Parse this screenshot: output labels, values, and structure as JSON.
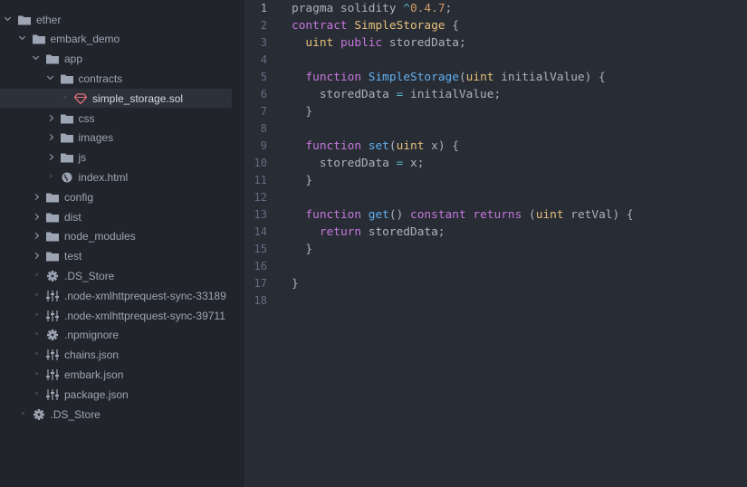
{
  "tree": {
    "items": [
      {
        "label": "ether",
        "depth": 0,
        "kind": "folder",
        "open": true
      },
      {
        "label": "embark_demo",
        "depth": 1,
        "kind": "folder",
        "open": true
      },
      {
        "label": "app",
        "depth": 2,
        "kind": "folder",
        "open": true
      },
      {
        "label": "contracts",
        "depth": 3,
        "kind": "folder",
        "open": true
      },
      {
        "label": "simple_storage.sol",
        "depth": 4,
        "kind": "file-solidity",
        "selected": true
      },
      {
        "label": "css",
        "depth": 3,
        "kind": "folder",
        "open": false
      },
      {
        "label": "images",
        "depth": 3,
        "kind": "folder",
        "open": false
      },
      {
        "label": "js",
        "depth": 3,
        "kind": "folder",
        "open": false
      },
      {
        "label": "index.html",
        "depth": 3,
        "kind": "file-html"
      },
      {
        "label": "config",
        "depth": 2,
        "kind": "folder",
        "open": false
      },
      {
        "label": "dist",
        "depth": 2,
        "kind": "folder",
        "open": false
      },
      {
        "label": "node_modules",
        "depth": 2,
        "kind": "folder",
        "open": false
      },
      {
        "label": "test",
        "depth": 2,
        "kind": "folder",
        "open": false
      },
      {
        "label": ".DS_Store",
        "depth": 2,
        "kind": "file-gear"
      },
      {
        "label": ".node-xmlhttprequest-sync-33189",
        "depth": 2,
        "kind": "file-config"
      },
      {
        "label": ".node-xmlhttprequest-sync-39711",
        "depth": 2,
        "kind": "file-config"
      },
      {
        "label": ".npmignore",
        "depth": 2,
        "kind": "file-gear"
      },
      {
        "label": "chains.json",
        "depth": 2,
        "kind": "file-config"
      },
      {
        "label": "embark.json",
        "depth": 2,
        "kind": "file-config"
      },
      {
        "label": "package.json",
        "depth": 2,
        "kind": "file-config"
      },
      {
        "label": ".DS_Store",
        "depth": 1,
        "kind": "file-gear"
      }
    ]
  },
  "editor": {
    "current_line": 1,
    "lines": [
      [
        {
          "t": "pragma solidity ",
          "c": ""
        },
        {
          "t": "^",
          "c": "op"
        },
        {
          "t": "0.4.7",
          "c": "nu"
        },
        {
          "t": ";",
          "c": ""
        }
      ],
      [
        {
          "t": "contract ",
          "c": "kw"
        },
        {
          "t": "SimpleStorage",
          "c": "ty"
        },
        {
          "t": " {",
          "c": ""
        }
      ],
      [
        {
          "t": "  ",
          "c": ""
        },
        {
          "t": "uint",
          "c": "ty"
        },
        {
          "t": " ",
          "c": ""
        },
        {
          "t": "public",
          "c": "kw"
        },
        {
          "t": " storedData;",
          "c": ""
        }
      ],
      [],
      [
        {
          "t": "  ",
          "c": ""
        },
        {
          "t": "function ",
          "c": "kw"
        },
        {
          "t": "SimpleStorage",
          "c": "fn"
        },
        {
          "t": "(",
          "c": ""
        },
        {
          "t": "uint",
          "c": "ty"
        },
        {
          "t": " initialValue) {",
          "c": ""
        }
      ],
      [
        {
          "t": "    storedData ",
          "c": ""
        },
        {
          "t": "=",
          "c": "op"
        },
        {
          "t": " initialValue;",
          "c": ""
        }
      ],
      [
        {
          "t": "  }",
          "c": ""
        }
      ],
      [],
      [
        {
          "t": "  ",
          "c": ""
        },
        {
          "t": "function ",
          "c": "kw"
        },
        {
          "t": "set",
          "c": "fn"
        },
        {
          "t": "(",
          "c": ""
        },
        {
          "t": "uint",
          "c": "ty"
        },
        {
          "t": " x) {",
          "c": ""
        }
      ],
      [
        {
          "t": "    storedData ",
          "c": ""
        },
        {
          "t": "=",
          "c": "op"
        },
        {
          "t": " x;",
          "c": ""
        }
      ],
      [
        {
          "t": "  }",
          "c": ""
        }
      ],
      [],
      [
        {
          "t": "  ",
          "c": ""
        },
        {
          "t": "function ",
          "c": "kw"
        },
        {
          "t": "get",
          "c": "fn"
        },
        {
          "t": "() ",
          "c": ""
        },
        {
          "t": "constant",
          "c": "kw"
        },
        {
          "t": " ",
          "c": ""
        },
        {
          "t": "returns",
          "c": "kw"
        },
        {
          "t": " (",
          "c": ""
        },
        {
          "t": "uint",
          "c": "ty"
        },
        {
          "t": " retVal) {",
          "c": ""
        }
      ],
      [
        {
          "t": "    ",
          "c": ""
        },
        {
          "t": "return",
          "c": "kw"
        },
        {
          "t": " storedData;",
          "c": ""
        }
      ],
      [
        {
          "t": "  }",
          "c": ""
        }
      ],
      [],
      [
        {
          "t": "}",
          "c": ""
        }
      ],
      []
    ]
  },
  "colors": {
    "tree_bg": "#21252b",
    "editor_bg": "#282c34",
    "keyword": "#c678dd",
    "type": "#e5c07b",
    "function": "#61afef",
    "number": "#d19a66"
  }
}
